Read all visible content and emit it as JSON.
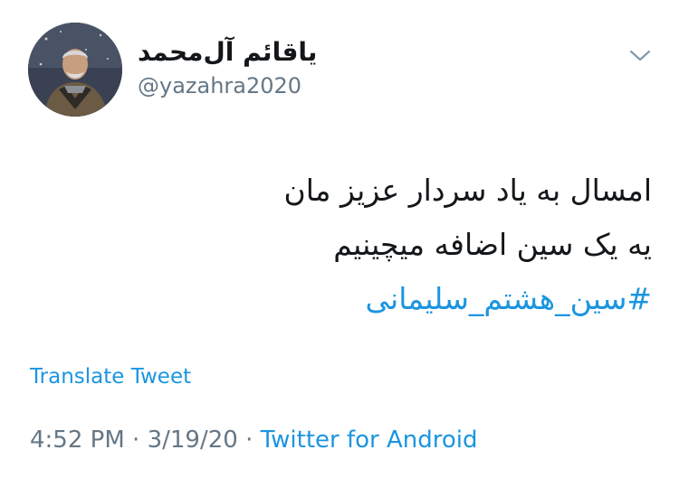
{
  "user": {
    "display_name": "یاقائم آل‌محمد",
    "handle": "@yazahra2020"
  },
  "tweet": {
    "lines": [
      "امسال به یاد سردار عزیز مان",
      "یه یک سین اضافه میچینیم"
    ],
    "hashtag": "#سین_هشتم_سلیمانی"
  },
  "actions": {
    "translate_label": "Translate Tweet"
  },
  "meta": {
    "time": "4:52 PM",
    "separator": "·",
    "date": "3/19/20",
    "source": "Twitter for Android"
  },
  "icons": {
    "menu": "chevron-down-icon"
  },
  "colors": {
    "link": "#1b95e0",
    "secondary_text": "#657786",
    "primary_text": "#14171a"
  }
}
